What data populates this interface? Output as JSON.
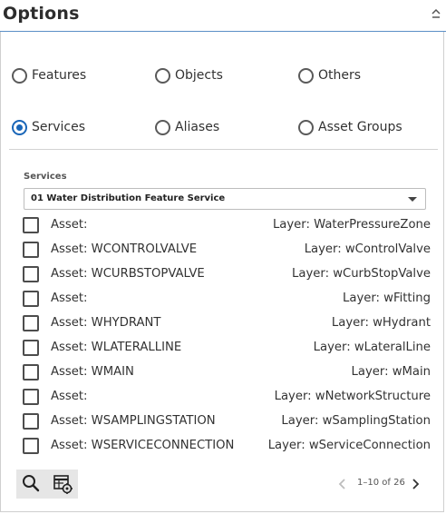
{
  "header": {
    "title": "Options",
    "collapse_icon": "chevron-up-icon"
  },
  "radios": {
    "features": {
      "label": "Features",
      "checked": false
    },
    "objects": {
      "label": "Objects",
      "checked": false
    },
    "others": {
      "label": "Others",
      "checked": false
    },
    "services": {
      "label": "Services",
      "checked": true
    },
    "aliases": {
      "label": "Aliases",
      "checked": false
    },
    "asset_groups": {
      "label": "Asset Groups",
      "checked": false
    }
  },
  "services": {
    "label": "Services",
    "selected": "01 Water Distribution Feature Service"
  },
  "rows": [
    {
      "asset": "Asset:",
      "layer": "Layer: WaterPressureZone",
      "checked": false
    },
    {
      "asset": "Asset: WCONTROLVALVE",
      "layer": "Layer: wControlValve",
      "checked": false
    },
    {
      "asset": "Asset: WCURBSTOPVALVE",
      "layer": "Layer: wCurbStopValve",
      "checked": false
    },
    {
      "asset": "Asset:",
      "layer": "Layer: wFitting",
      "checked": false
    },
    {
      "asset": "Asset: WHYDRANT",
      "layer": "Layer: wHydrant",
      "checked": false
    },
    {
      "asset": "Asset: WLATERALLINE",
      "layer": "Layer: wLateralLine",
      "checked": false
    },
    {
      "asset": "Asset: WMAIN",
      "layer": "Layer: wMain",
      "checked": false
    },
    {
      "asset": "Asset:",
      "layer": "Layer: wNetworkStructure",
      "checked": false
    },
    {
      "asset": "Asset: WSAMPLINGSTATION",
      "layer": "Layer: wSamplingStation",
      "checked": false
    },
    {
      "asset": "Asset: WSERVICECONNECTION",
      "layer": "Layer: wServiceConnection",
      "checked": false
    }
  ],
  "toolbar": {
    "search_icon": "search-icon",
    "settings_icon": "table-settings-icon"
  },
  "pager": {
    "text": "1–10 of 26",
    "prev_icon": "chevron-left-icon",
    "next_icon": "chevron-right-icon"
  },
  "colors": {
    "accent": "#1a66b8",
    "header_rule": "#5b8fc7",
    "toolbar_bg": "#e6e6e6"
  }
}
